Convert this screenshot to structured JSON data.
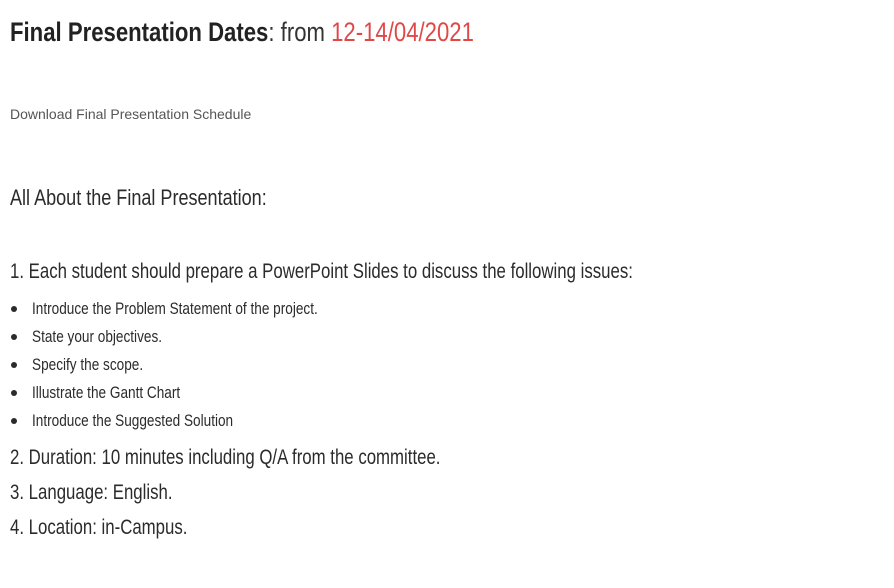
{
  "header": {
    "title_bold": "Final Presentation Dates",
    "title_separator": ": from ",
    "title_dates": "12-14/04/2021",
    "accent_color": "#e04848"
  },
  "download": {
    "link_text": "Download Final Presentation Schedule"
  },
  "section": {
    "heading": "All About the Final Presentation:"
  },
  "items": {
    "item1": "1. Each student should prepare a PowerPoint Slides to discuss the following issues:",
    "bullets": [
      "Introduce the Problem Statement of the project.",
      "State your objectives.",
      "Specify the scope.",
      "Illustrate the Gantt Chart",
      "Introduce the Suggested Solution"
    ],
    "item2": "2. Duration: 10 minutes including Q/A from the committee.",
    "item3": "3. Language: English.",
    "item4": "4. Location: in-Campus."
  }
}
